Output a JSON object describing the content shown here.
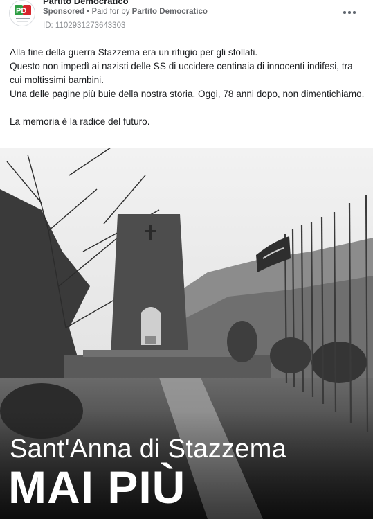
{
  "post": {
    "page_name": "Partito Democratico",
    "sponsored_label": "Sponsored",
    "separator": " • ",
    "paid_prefix": "Paid for by ",
    "paid_by": "Partito Democratico",
    "ad_id": "ID: 1102931273643303",
    "more_icon": "more-horizontal-icon",
    "avatar_logo": "PD"
  },
  "body_text": {
    "line1": "Alla fine della guerra Stazzema era un rifugio per gli sfollati.",
    "line2": "Questo non impedì ai nazisti delle SS di uccidere centinaia di innocenti indifesi, tra cui moltissimi bambini.",
    "line3": "Una delle pagine più buie della nostra storia. Oggi, 78 anni dopo, non dimentichiamo.",
    "line4": "La memoria è la radice del futuro."
  },
  "image": {
    "title": "Sant'Anna di Stazzema",
    "headline": "MAI PIÙ"
  },
  "colors": {
    "logo_green": "#2f9e44",
    "logo_red": "#d6242b",
    "secondary_text": "#65676b"
  }
}
